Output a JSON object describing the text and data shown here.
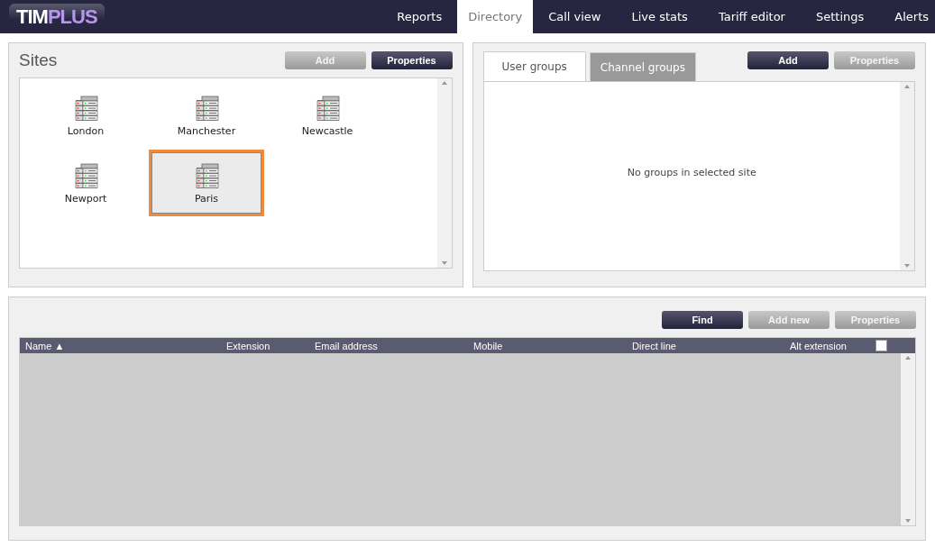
{
  "logo": {
    "part_1": "TIM",
    "part_2": "PLUS"
  },
  "nav": [
    {
      "label": "Reports",
      "selected": false
    },
    {
      "label": "Directory",
      "selected": true
    },
    {
      "label": "Call view",
      "selected": false
    },
    {
      "label": "Live stats",
      "selected": false
    },
    {
      "label": "Tariff editor",
      "selected": false
    },
    {
      "label": "Settings",
      "selected": false
    },
    {
      "label": "Alerts",
      "selected": false
    }
  ],
  "sites": {
    "title": "Sites",
    "buttons": [
      {
        "label": "Add",
        "disabled": true
      },
      {
        "label": "Properties",
        "disabled": false
      }
    ],
    "items": [
      {
        "label": "London",
        "selected": false
      },
      {
        "label": "Manchester",
        "selected": false
      },
      {
        "label": "Newcastle",
        "selected": false
      },
      {
        "label": "Newport",
        "selected": false
      },
      {
        "label": "Paris",
        "selected": true
      }
    ]
  },
  "groups": {
    "tabs": [
      {
        "label": "User groups",
        "selected": true
      },
      {
        "label": "Channel groups",
        "selected": false
      }
    ],
    "buttons": [
      {
        "label": "Add",
        "disabled": false
      },
      {
        "label": "Properties",
        "disabled": true
      }
    ],
    "empty_message": "No groups in selected site"
  },
  "directory": {
    "buttons": [
      {
        "label": "Find",
        "disabled": false
      },
      {
        "label": "Add new",
        "disabled": true
      },
      {
        "label": "Properties",
        "disabled": true
      }
    ],
    "columns": [
      "Name ▲",
      "Extension",
      "Email address",
      "Mobile",
      "Direct line",
      "Alt extension"
    ],
    "select_all_checked": false
  }
}
